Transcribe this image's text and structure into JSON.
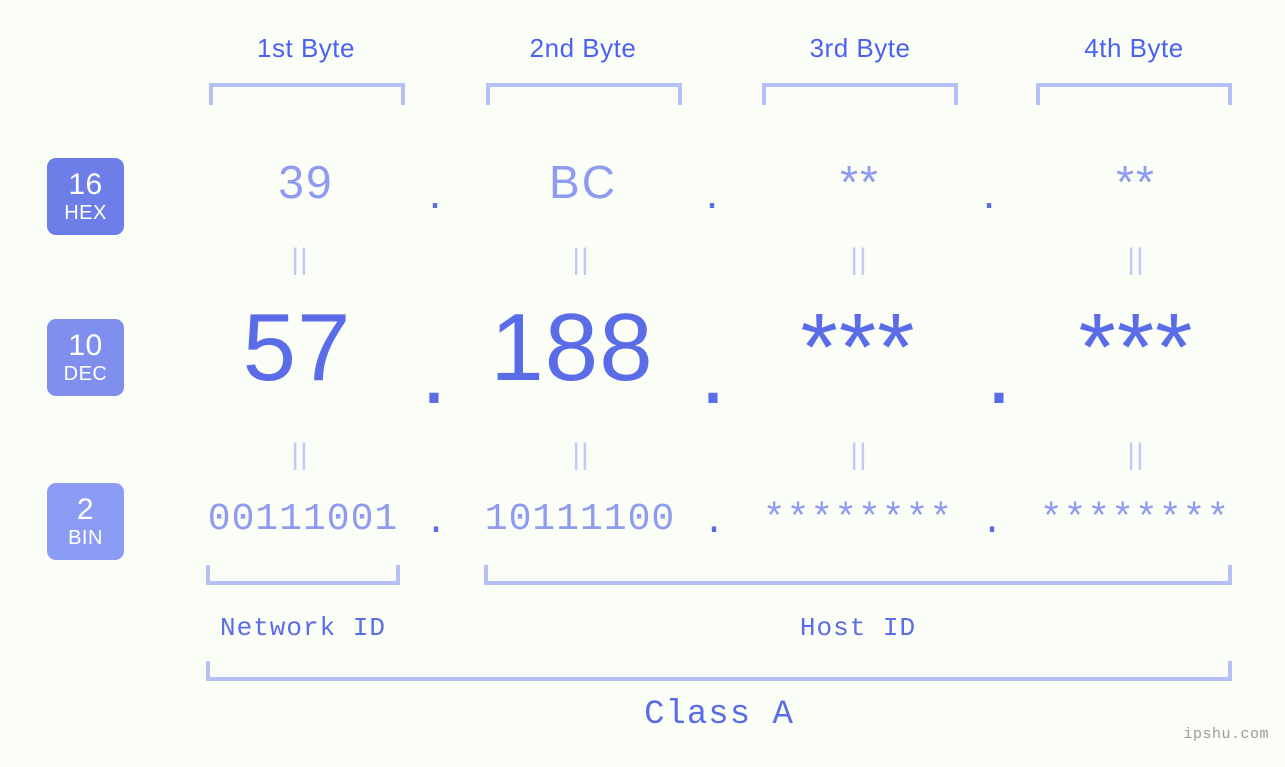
{
  "page": {
    "background_color": "#fbfdf7",
    "accent_dark": "#5b6ce8",
    "accent_light": "#8e9bf0",
    "bracket_color": "#b6bff6",
    "separator_color": "#c3caf8",
    "watermark": "ipshu.com"
  },
  "headers": [
    {
      "label": "1st Byte"
    },
    {
      "label": "2nd Byte"
    },
    {
      "label": "3rd Byte"
    },
    {
      "label": "4th Byte"
    }
  ],
  "bases": [
    {
      "number": "16",
      "name": "HEX",
      "color": "#6e7ee8"
    },
    {
      "number": "10",
      "name": "DEC",
      "color": "#808fee"
    },
    {
      "number": "2",
      "name": "BIN",
      "color": "#8c9cf5"
    }
  ],
  "rows": {
    "hex": {
      "base_number": "16",
      "base_name": "HEX",
      "values": [
        "39",
        "BC",
        "**",
        "**"
      ],
      "separator": "."
    },
    "dec": {
      "base_number": "10",
      "base_name": "DEC",
      "values": [
        "57",
        "188",
        "***",
        "***"
      ],
      "separator": "."
    },
    "bin": {
      "base_number": "2",
      "base_name": "BIN",
      "values": [
        "00111001",
        "10111100",
        "********",
        "********"
      ],
      "separator": "."
    }
  },
  "equals_symbol": "||",
  "segments": {
    "network_id": "Network ID",
    "host_id": "Host ID",
    "ip_class": "Class A"
  }
}
